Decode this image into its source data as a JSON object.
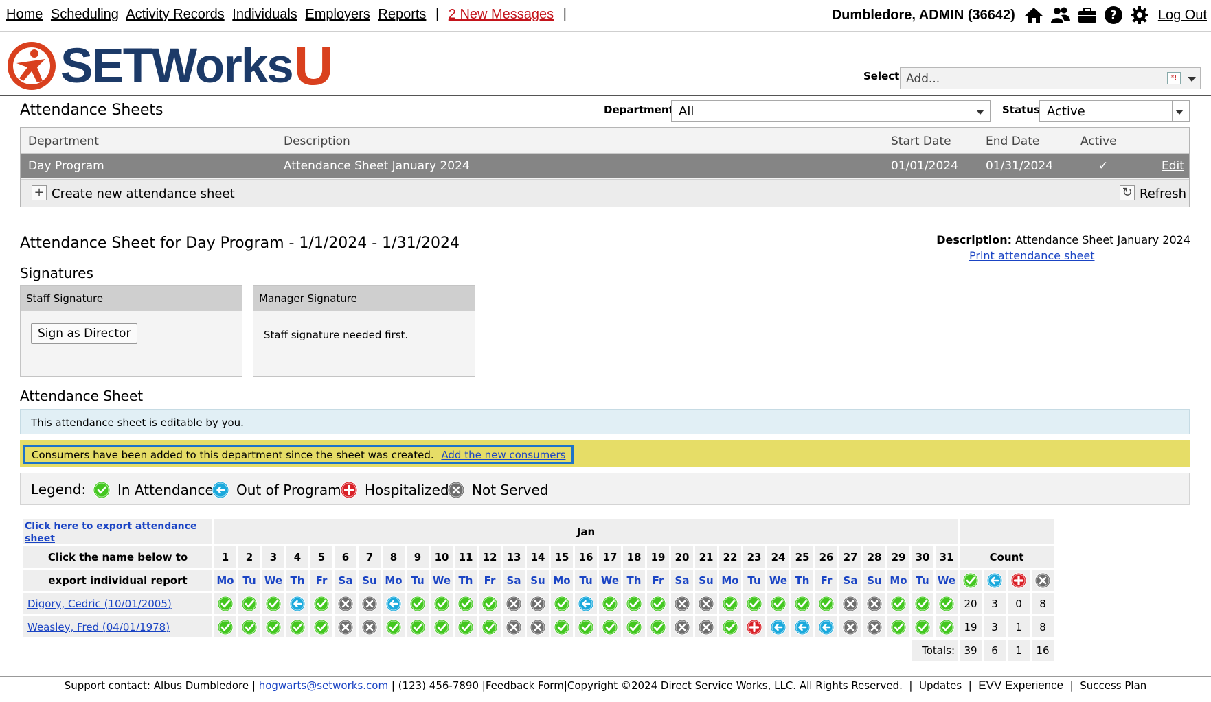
{
  "nav": {
    "links": [
      "Home",
      "Scheduling",
      "Activity Records",
      "Individuals",
      "Employers",
      "Reports"
    ],
    "messages": "2 New Messages",
    "separator": "|",
    "user": "Dumbledore, ADMIN  (36642)",
    "logout": "Log Out",
    "icons": [
      "home-icon",
      "people-icon",
      "briefcase-icon",
      "help-icon",
      "gear-icon"
    ]
  },
  "brand": {
    "word": "SETWorks",
    "suffix": "U"
  },
  "select": {
    "label": "Select:",
    "placeholder": "Add..."
  },
  "sheets": {
    "title": "Attendance Sheets",
    "department_label": "Department:",
    "department_value": "All",
    "status_label": "Status:",
    "status_value": "Active",
    "columns": [
      "Department",
      "Description",
      "Start Date",
      "End Date",
      "Active"
    ],
    "row": {
      "department": "Day Program",
      "description": "Attendance Sheet January 2024",
      "start": "01/01/2024",
      "end": "01/31/2024",
      "active": "✓",
      "edit": "Edit"
    },
    "create": "Create new attendance sheet",
    "refresh": "Refresh"
  },
  "detail": {
    "title": "Attendance Sheet for Day Program - 1/1/2024 - 1/31/2024",
    "desc_label": "Description:",
    "desc_value": "Attendance Sheet January 2024",
    "print": "Print attendance sheet",
    "signatures_title": "Signatures",
    "staff_sig_title": "Staff Signature",
    "sign_button": "Sign as Director",
    "manager_sig_title": "Manager Signature",
    "manager_msg": "Staff signature needed first.",
    "sheet_title": "Attendance Sheet",
    "editable_msg": "This attendance sheet is editable by you.",
    "warn_msg": "Consumers have been added to this department since the sheet was created.",
    "warn_link": "Add the new consumers",
    "legend_label": "Legend:",
    "legend": [
      {
        "code": "A",
        "label": "In Attendance"
      },
      {
        "code": "O",
        "label": "Out of Program"
      },
      {
        "code": "H",
        "label": "Hospitalized"
      },
      {
        "code": "N",
        "label": "Not Served"
      }
    ]
  },
  "colors": {
    "A": "#43c71f",
    "O": "#1aa9dc",
    "H": "#d91f26",
    "N": "#6d6d6d"
  },
  "table": {
    "export_link": "Click here to export attendance sheet",
    "month": "Jan",
    "instr1": "Click the name below to",
    "instr2": "export individual report",
    "count_label": "Count",
    "days": [
      "1",
      "2",
      "3",
      "4",
      "5",
      "6",
      "7",
      "8",
      "9",
      "10",
      "11",
      "12",
      "13",
      "14",
      "15",
      "16",
      "17",
      "18",
      "19",
      "20",
      "21",
      "22",
      "23",
      "24",
      "25",
      "26",
      "27",
      "28",
      "29",
      "30",
      "31"
    ],
    "dows": [
      "Mo",
      "Tu",
      "We",
      "Th",
      "Fr",
      "Sa",
      "Su",
      "Mo",
      "Tu",
      "We",
      "Th",
      "Fr",
      "Sa",
      "Su",
      "Mo",
      "Tu",
      "We",
      "Th",
      "Fr",
      "Sa",
      "Su",
      "Mo",
      "Tu",
      "We",
      "Th",
      "Fr",
      "Sa",
      "Su",
      "Mo",
      "Tu",
      "We"
    ],
    "rows": [
      {
        "name": "Digory, Cedric (10/01/2005)",
        "status": [
          "A",
          "A",
          "A",
          "O",
          "A",
          "N",
          "N",
          "O",
          "A",
          "A",
          "A",
          "A",
          "N",
          "N",
          "A",
          "O",
          "A",
          "A",
          "A",
          "N",
          "N",
          "A",
          "A",
          "A",
          "A",
          "A",
          "N",
          "N",
          "A",
          "A",
          "A"
        ],
        "counts": [
          "20",
          "3",
          "0",
          "8"
        ]
      },
      {
        "name": "Weasley, Fred (04/01/1978)",
        "status": [
          "A",
          "A",
          "A",
          "A",
          "A",
          "N",
          "N",
          "A",
          "A",
          "A",
          "A",
          "A",
          "N",
          "N",
          "A",
          "A",
          "A",
          "A",
          "A",
          "N",
          "N",
          "A",
          "H",
          "O",
          "O",
          "O",
          "N",
          "N",
          "A",
          "A",
          "A"
        ],
        "counts": [
          "19",
          "3",
          "1",
          "8"
        ]
      }
    ],
    "totals_label": "Totals:",
    "totals": [
      "39",
      "6",
      "1",
      "16"
    ]
  },
  "footer": {
    "support": "Support contact: Albus Dumbledore",
    "email": "hogwarts@setworks.com",
    "phone": "(123) 456-7890",
    "feedback": "Feedback Form",
    "copyright": "Copyright ©2024 Direct Service Works, LLC. All Rights Reserved.",
    "updates": "Updates",
    "evv": "EVV Experience",
    "success": "Success Plan"
  }
}
